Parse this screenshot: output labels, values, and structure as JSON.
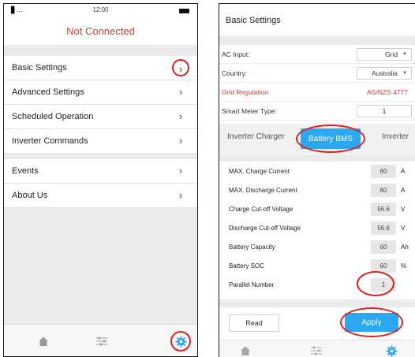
{
  "left_screen": {
    "status_bar": {
      "signal": "▐▌…",
      "time": "12:00"
    },
    "connection_status": "Not Connected",
    "menu_items": [
      {
        "label": "Basic Settings",
        "chevron": "›"
      },
      {
        "label": "Advanced Settings",
        "chevron": "›"
      },
      {
        "label": "Scheduled Operation",
        "chevron": "›"
      },
      {
        "label": "Inverter Commands",
        "chevron": "›"
      },
      {
        "label": "Events",
        "chevron": "›"
      },
      {
        "label": "About Us",
        "chevron": "›"
      }
    ],
    "tab_bar": [
      "home-icon",
      "sliders-icon",
      "gear-icon"
    ],
    "colors": {
      "alert_red": "#e23b3b",
      "accent_blue": "#2aa8f2",
      "annotation_red": "#e02020"
    }
  },
  "right_screen": {
    "title": "Basic Settings",
    "fields": [
      {
        "label": "AC Input:",
        "value": "Grid",
        "dropdown": true
      },
      {
        "label": "Country:",
        "value": "Australia",
        "dropdown": true
      },
      {
        "label": "Grid Regulation",
        "value": "AS/NZS 4777",
        "dropdown": false
      },
      {
        "label": "Smart Meter Type:",
        "value": "1",
        "dropdown": false
      }
    ],
    "tabs": [
      {
        "label": "Inverter Charger",
        "active": false
      },
      {
        "label": "Battery BMS",
        "active": true
      },
      {
        "label": "Inverter",
        "active": false
      }
    ],
    "bms_rows": [
      {
        "label": "MAX. Charge Current",
        "value": "60",
        "unit": "A"
      },
      {
        "label": "MAX. Discharge Current",
        "value": "60",
        "unit": "A"
      },
      {
        "label": "Charge Cut-off Voltage",
        "value": "56.6",
        "unit": "V"
      },
      {
        "label": "Discharge Cut-off Voltage",
        "value": "56.6",
        "unit": "V"
      },
      {
        "label": "Battery Capacity",
        "value": "60",
        "unit": "Ah"
      },
      {
        "label": "Battery SOC",
        "value": "60",
        "unit": "%"
      },
      {
        "label": "Parallel Number",
        "value": "1",
        "unit": ""
      }
    ],
    "buttons": {
      "read": "Read",
      "apply": "Apply"
    },
    "tab_bar": [
      "home-icon",
      "sliders-icon",
      "gear-icon"
    ]
  }
}
